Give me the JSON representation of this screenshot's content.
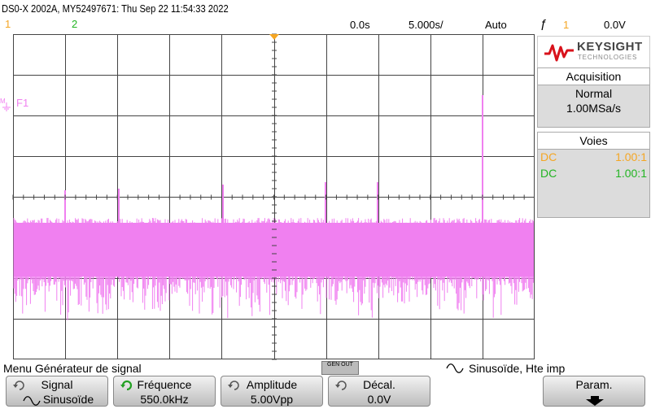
{
  "header": {
    "title": "DS0-X 2002A, MY52497671: Thu Sep 22 11:54:33 2022",
    "channel1": "1",
    "channel2": "2",
    "time_offset": "0.0s",
    "time_scale": "5.000s/",
    "trigger_mode": "Auto",
    "trigger_channel": "1",
    "trigger_level": "0.0V"
  },
  "scope": {
    "fn_label": "F1",
    "colors": {
      "ch1": "#f5a623",
      "ch2": "#22b422",
      "trace": "#f080f0",
      "trigger": "#f5a623"
    }
  },
  "brand": {
    "name": "KEYSIGHT",
    "sub": "TECHNOLOGIES"
  },
  "acquisition": {
    "title": "Acquisition",
    "mode": "Normal",
    "rate": "1.00MSa/s"
  },
  "channels": {
    "title": "Voies",
    "rows": [
      {
        "coupling": "DC",
        "probe": "1.00:1",
        "color": "#f5a623"
      },
      {
        "coupling": "DC",
        "probe": "1.00:1",
        "color": "#22b422"
      }
    ]
  },
  "menu": {
    "title": "Menu Générateur de signal",
    "gen_badge": "GEN OUT",
    "waveform_info": "Sinusoïde, Hte imp"
  },
  "softkeys": [
    {
      "label": "Signal",
      "value": "Sinusoïde"
    },
    {
      "label": "Fréquence",
      "value": "550.0kHz"
    },
    {
      "label": "Amplitude",
      "value": "5.00Vpp"
    },
    {
      "label": "Décal.",
      "value": "0.0V"
    },
    {
      "label": "Param.",
      "value": ""
    }
  ]
}
